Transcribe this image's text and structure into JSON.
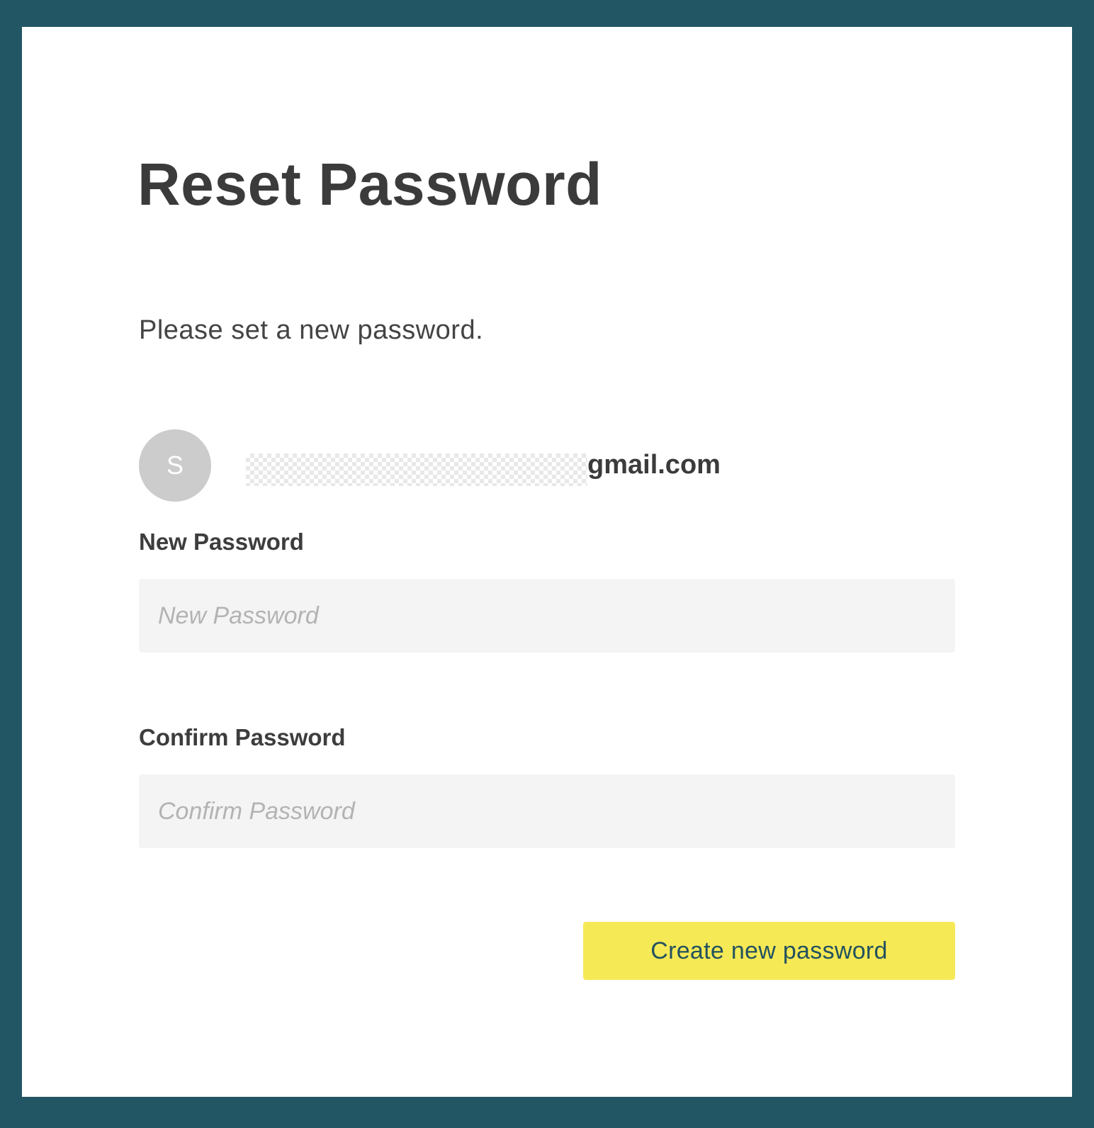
{
  "colors": {
    "frame": "#235664",
    "card": "#ffffff",
    "input_background": "#f4f4f4",
    "avatar_background": "#cccccc",
    "primary_button": "#f6e956",
    "primary_button_text": "#23525e"
  },
  "page": {
    "title": "Reset Password",
    "subtitle": "Please set a new password."
  },
  "account": {
    "avatar_initial": "S",
    "email_visible_part": "gmail.com",
    "email_redacted": true
  },
  "form": {
    "new_password": {
      "label": "New Password",
      "placeholder": "New Password",
      "value": ""
    },
    "confirm_password": {
      "label": "Confirm Password",
      "placeholder": "Confirm Password",
      "value": ""
    },
    "submit_label": "Create new password"
  }
}
